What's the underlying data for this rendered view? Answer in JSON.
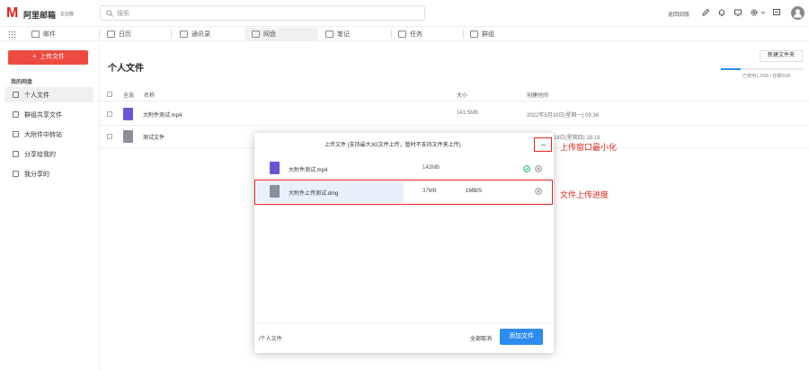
{
  "brand": {
    "logo_mark": "M",
    "logo_text": "阿里邮箱",
    "edition_badge": "企业版"
  },
  "search": {
    "placeholder": "搜索"
  },
  "topbar": {
    "legacy_link": "返回旧版",
    "icons": [
      "pen-icon",
      "bell-icon",
      "device-icon",
      "gear-icon",
      "chevron-down-icon",
      "message-icon",
      "avatar-icon"
    ]
  },
  "nav": {
    "items": [
      {
        "label": "邮件",
        "icon": "mail-icon"
      },
      {
        "label": "日历",
        "icon": "calendar-icon"
      },
      {
        "label": "通讯录",
        "icon": "contacts-icon"
      },
      {
        "label": "网盘",
        "icon": "drive-icon",
        "active": true
      },
      {
        "label": "笔记",
        "icon": "note-icon"
      },
      {
        "label": "任务",
        "icon": "task-icon"
      },
      {
        "label": "群组",
        "icon": "group-icon"
      }
    ]
  },
  "sidebar": {
    "upload_button": "上传文件",
    "section_title": "我的网盘",
    "items": [
      {
        "label": "个人文件",
        "icon": "user-icon",
        "active": true
      },
      {
        "label": "群组共享文件",
        "icon": "folder-share-icon"
      },
      {
        "label": "大附件中转站",
        "icon": "transfer-icon"
      },
      {
        "label": "分享给我的",
        "icon": "share-in-icon"
      },
      {
        "label": "我分享的",
        "icon": "share-out-icon"
      }
    ]
  },
  "main": {
    "title": "个人文件",
    "new_folder_button": "新建文件夹",
    "usage": {
      "text": "已使用1.2GB / 容量5GB",
      "used_fraction": 0.24
    },
    "columns": {
      "select_all": "全选",
      "name": "名称",
      "size": "大小",
      "created": "创建时间"
    },
    "files": [
      {
        "name": "大附件测试.mp4",
        "type": "video",
        "size": "141.5MB",
        "created": "2022年5月18日(星期一) 09:36"
      },
      {
        "name": "测试文件",
        "type": "doc",
        "size": "",
        "created": "...18日(星期四) 18:19"
      }
    ]
  },
  "upload_dialog": {
    "title": "上传文件 (支持最大3G文件上传，暂时不支持文件夹上传)",
    "minimize_icon": "minus-icon",
    "items": [
      {
        "name": "大附件测试.mp4",
        "type": "video",
        "size": "142MB",
        "speed": "",
        "status": "done"
      },
      {
        "name": "大附件上传测试.dmg",
        "type": "doc",
        "size": "37MB",
        "speed": "1MB/S",
        "status": "uploading",
        "progress": 0.5
      }
    ],
    "footer_path": "/个人文件",
    "cancel_all": "全部取消",
    "add_file": "添加文件"
  },
  "annotations": {
    "minimize": "上传窗口最小化",
    "progress": "文件上传进度"
  },
  "colors": {
    "brand_red": "#e2231a",
    "accent_blue": "#2d8cf0",
    "video_purple": "#6b55d4"
  }
}
